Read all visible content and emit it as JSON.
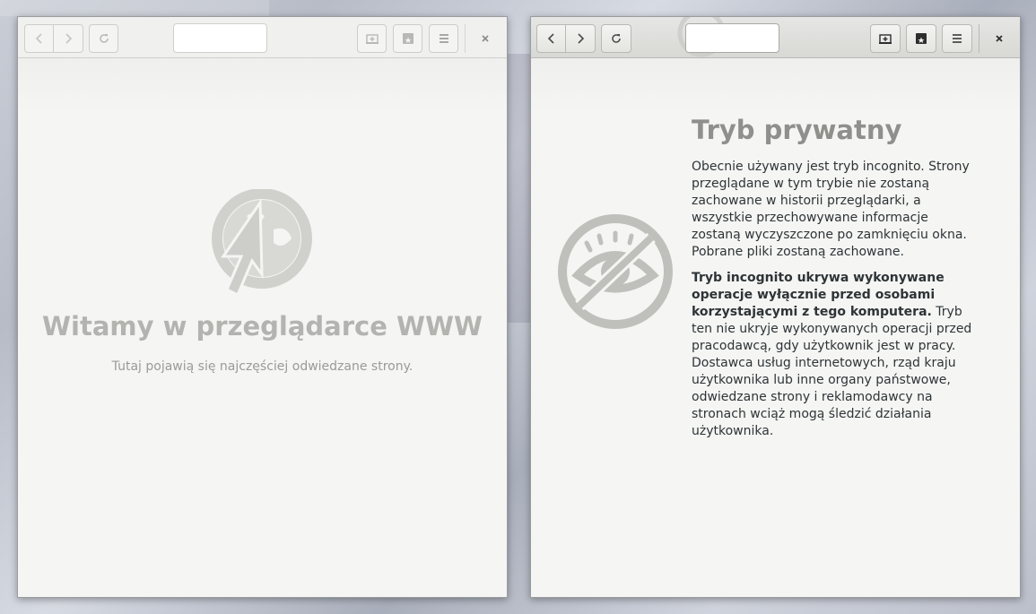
{
  "left_window": {
    "welcome_title": "Witamy w przeglądarce WWW",
    "welcome_subtitle": "Tutaj pojawią się najczęściej odwiedzane strony.",
    "icons": {
      "back": "chevron-left-icon",
      "forward": "chevron-right-icon",
      "reload": "reload-icon",
      "new_tab": "new-tab-icon",
      "bookmarks": "bookmark-icon",
      "menu": "hamburger-menu-icon",
      "close": "close-icon"
    }
  },
  "right_window": {
    "title": "Tryb prywatny",
    "paragraph1": "Obecnie używany jest tryb incognito. Strony przeglądane w tym trybie nie zostaną zachowane w historii przeglądarki, a wszystkie przechowywane informacje zostaną wyczyszczone po zamknięciu okna. Pobrane pliki zostaną zachowane.",
    "paragraph2_bold": "Tryb incognito ukrywa wykonywane operacje wyłącznie przed osobami korzystającymi z tego komputera.",
    "paragraph2_rest": " Tryb ten nie ukryje wykonywanych operacji przed pracodawcą, gdy użytkownik jest w pracy. Dostawca usług internetowych, rząd kraju użytkownika lub inne organy państwowe, odwiedzane strony i reklamodawcy na stronach wciąż mogą śledzić działania użytkownika."
  },
  "colors": {
    "window_bg": "#f5f5f4",
    "muted_text": "#b3b3b0",
    "body_text": "#2e3436",
    "icon_gray": "#c3c3bf"
  }
}
